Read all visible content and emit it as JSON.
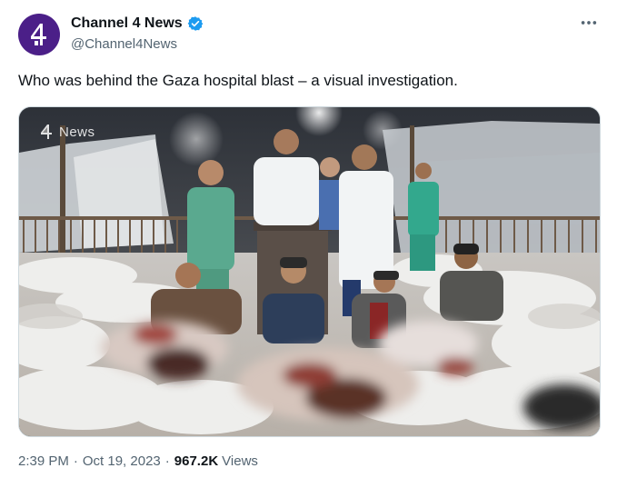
{
  "author": {
    "display_name": "Channel 4 News",
    "handle": "@Channel4News",
    "verified": true,
    "avatar_icon": "channel-4-logo-icon",
    "avatar_color": "#4b1f88"
  },
  "tweet": {
    "text": "Who was behind the Gaza hospital blast – a visual investigation.",
    "time": "2:39 PM",
    "date": "Oct 19, 2023",
    "views_count": "967.2K",
    "views_label": "Views",
    "separator": "·"
  },
  "media": {
    "watermark_text": "News",
    "watermark_icon": "channel-4-logo-icon"
  },
  "menu": {
    "icon": "more-horizontal-icon"
  },
  "colors": {
    "verified": "#1d9bf0",
    "secondary_text": "#536471",
    "primary_text": "#0f1419"
  }
}
